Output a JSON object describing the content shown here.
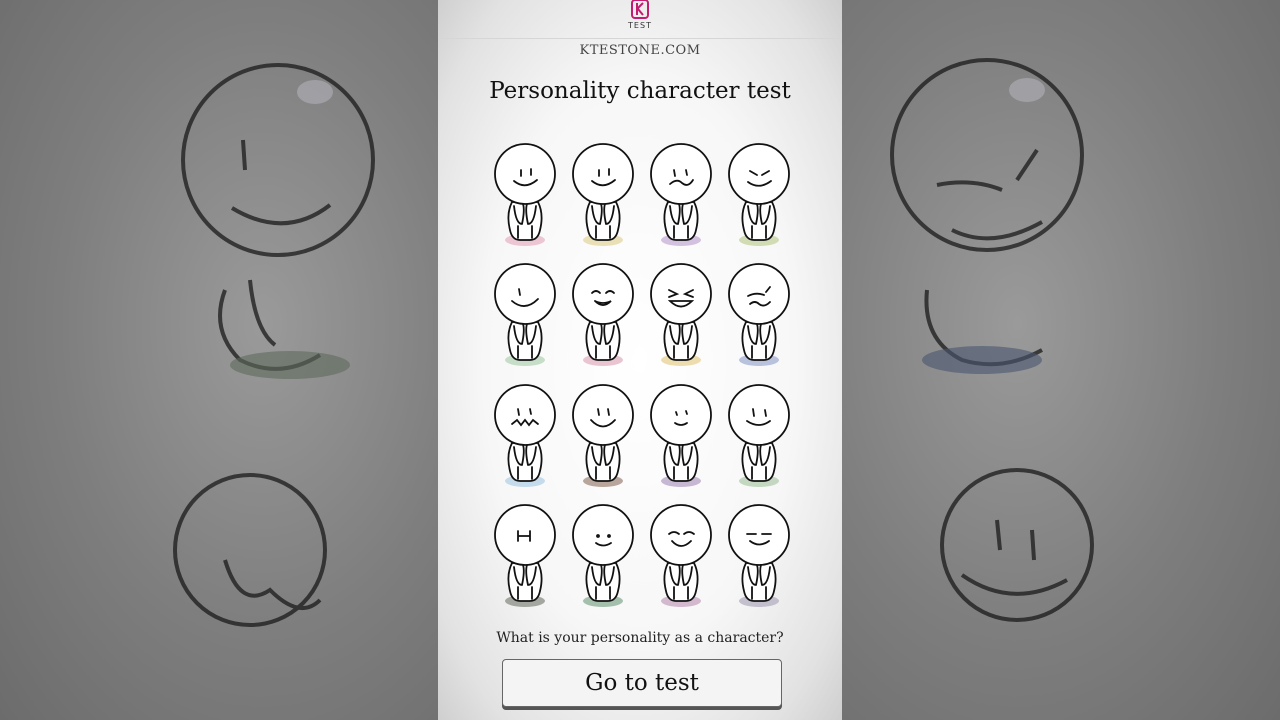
{
  "header": {
    "logo_text": "TEST",
    "site": "KTESTONE.COM"
  },
  "main": {
    "title": "Personality character test",
    "question": "What is your personality as a character?",
    "cta_label": "Go to test"
  },
  "characters": [
    {
      "face": "smile-lines",
      "tint": "#e8b9c8"
    },
    {
      "face": "smile-lines",
      "tint": "#e6d9a6"
    },
    {
      "face": "smirk",
      "tint": "#c9b3d9"
    },
    {
      "face": "angry-smile",
      "tint": "#c7d3a3"
    },
    {
      "face": "grin",
      "tint": "#b9d6bb"
    },
    {
      "face": "happy-closed",
      "tint": "#e3b6c6"
    },
    {
      "face": "laugh-squint",
      "tint": "#e9d59a"
    },
    {
      "face": "wink-frown",
      "tint": "#a8b4d6"
    },
    {
      "face": "wavy",
      "tint": "#b5d3e6"
    },
    {
      "face": "big-smile",
      "tint": "#a89186"
    },
    {
      "face": "small-smile",
      "tint": "#b9a7c9"
    },
    {
      "face": "calm",
      "tint": "#b7ceb1"
    },
    {
      "face": "shocked",
      "tint": "#8f9489"
    },
    {
      "face": "dot-smile",
      "tint": "#8fb19a"
    },
    {
      "face": "content",
      "tint": "#c9a9c2"
    },
    {
      "face": "sleepy",
      "tint": "#b7b1c2"
    }
  ]
}
